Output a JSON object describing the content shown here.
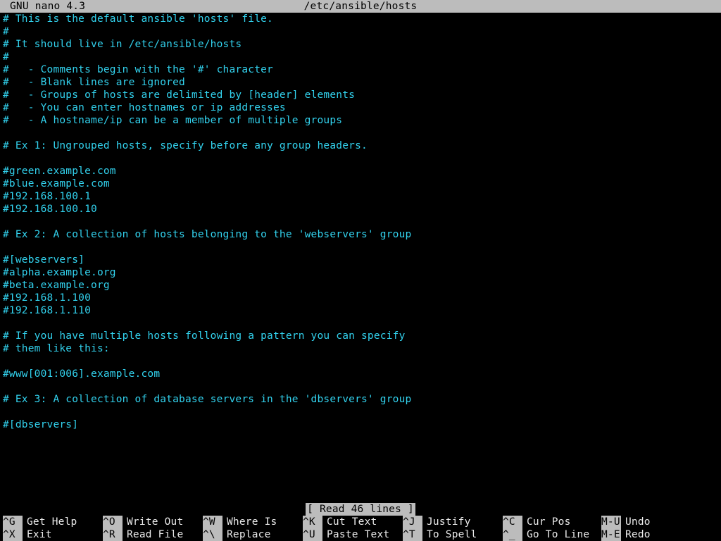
{
  "title_left": "GNU nano 4.3",
  "title_center": "/etc/ansible/hosts",
  "status_text": "[ Read 46 lines ]",
  "editor_lines": [
    "# This is the default ansible 'hosts' file.",
    "#",
    "# It should live in /etc/ansible/hosts",
    "#",
    "#   - Comments begin with the '#' character",
    "#   - Blank lines are ignored",
    "#   - Groups of hosts are delimited by [header] elements",
    "#   - You can enter hostnames or ip addresses",
    "#   - A hostname/ip can be a member of multiple groups",
    "",
    "# Ex 1: Ungrouped hosts, specify before any group headers.",
    "",
    "#green.example.com",
    "#blue.example.com",
    "#192.168.100.1",
    "#192.168.100.10",
    "",
    "# Ex 2: A collection of hosts belonging to the 'webservers' group",
    "",
    "#[webservers]",
    "#alpha.example.org",
    "#beta.example.org",
    "#192.168.1.100",
    "#192.168.1.110",
    "",
    "# If you have multiple hosts following a pattern you can specify",
    "# them like this:",
    "",
    "#www[001:006].example.com",
    "",
    "# Ex 3: A collection of database servers in the 'dbservers' group",
    "",
    "#[dbservers]",
    ""
  ],
  "shortcuts": {
    "row1": [
      {
        "key": "^G",
        "label": "Get Help"
      },
      {
        "key": "^O",
        "label": "Write Out"
      },
      {
        "key": "^W",
        "label": "Where Is"
      },
      {
        "key": "^K",
        "label": "Cut Text"
      },
      {
        "key": "^J",
        "label": "Justify"
      },
      {
        "key": "^C",
        "label": "Cur Pos"
      }
    ],
    "row1_extra": {
      "key": "M-U",
      "label": "Undo"
    },
    "row2": [
      {
        "key": "^X",
        "label": "Exit"
      },
      {
        "key": "^R",
        "label": "Read File"
      },
      {
        "key": "^\\",
        "label": "Replace"
      },
      {
        "key": "^U",
        "label": "Paste Text"
      },
      {
        "key": "^T",
        "label": "To Spell"
      },
      {
        "key": "^_",
        "label": "Go To Line"
      }
    ],
    "row2_extra": {
      "key": "M-E",
      "label": "Redo"
    }
  }
}
